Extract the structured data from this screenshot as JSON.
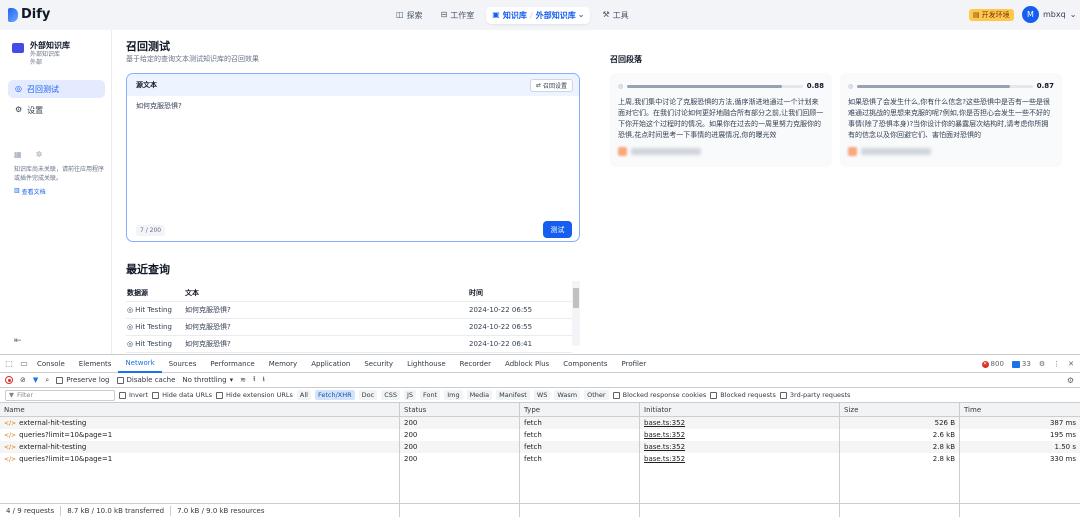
{
  "app": {
    "logo": "Dify",
    "nav": {
      "explore": "探索",
      "studio": "工作室",
      "knowledge": "知识库",
      "knowledge_sub": "外部知识库",
      "tools": "工具"
    },
    "env_badge": "开发环境",
    "user": {
      "initial": "M",
      "name": "mbxq"
    }
  },
  "sidebar": {
    "kb_name": "外部知识库",
    "kb_type": "外部知识库",
    "kb_sub": "外部",
    "items": [
      {
        "label": "召回测试"
      },
      {
        "label": "设置"
      }
    ],
    "note": "知识库尚未关联，请前往应用程序或插件完成关联。",
    "doc_link": "查看文档"
  },
  "main": {
    "title": "召回测试",
    "subtitle": "基于给定的查询文本测试知识库的召回效果",
    "source_label": "源文本",
    "setting_button": "召回设置",
    "query": "如何克服恐惧?",
    "counter": "7 / 200",
    "test_button": "测试",
    "recent_title": "最近查询",
    "recent": {
      "headers": [
        "数据源",
        "文本",
        "时间"
      ],
      "rows": [
        [
          "Hit Testing",
          "如何克服恐惧?",
          "2024-10-22 06:55"
        ],
        [
          "Hit Testing",
          "如何克服恐惧?",
          "2024-10-22 06:55"
        ],
        [
          "Hit Testing",
          "如何克服恐惧?",
          "2024-10-22 06:41"
        ]
      ]
    }
  },
  "results": {
    "title": "召回段落",
    "cards": [
      {
        "score": 0.88,
        "score_label": "0.88",
        "text": "上周,我们集中讨论了克服恐惧的方法,循序渐进地通过一个计划来面对它们。在我们讨论如何更好地融合所有部分之前,让我们回顾一下你开始这个过程时的情况。如果你在过去的一周里努力克服你的恐惧,花点时间思考一下事情的进展情况,你的曝光效"
      },
      {
        "score": 0.87,
        "score_label": "0.87",
        "text": "如果恐惧了会发生什么,你有什么信念?这些恐惧中是否有一些是很难通过挑战的思想来克服的呢?例如,你是否担心会发生一些不好的事情(除了恐惧本身)?当你设计你的暴露层次结构时,请考虑你所拥有的信念以及你回避它们、害怕面对恐惧的"
      }
    ]
  },
  "devtools": {
    "tabs": [
      "Console",
      "Elements",
      "Network",
      "Sources",
      "Performance",
      "Memory",
      "Application",
      "Security",
      "Lighthouse",
      "Recorder",
      "Adblock Plus",
      "Components",
      "Profiler"
    ],
    "errors": "800",
    "messages": "33",
    "toolbar": {
      "preserve_log": "Preserve log",
      "disable_cache": "Disable cache",
      "throttling": "No throttling"
    },
    "filter": {
      "placeholder": "Filter",
      "invert": "Invert",
      "hide_data_urls": "Hide data URLs",
      "hide_ext_urls": "Hide extension URLs",
      "chips": [
        "All",
        "Fetch/XHR",
        "Doc",
        "CSS",
        "JS",
        "Font",
        "Img",
        "Media",
        "Manifest",
        "WS",
        "Wasm",
        "Other"
      ],
      "blocked_cookies": "Blocked response cookies",
      "blocked_requests": "Blocked requests",
      "third_party": "3rd-party requests"
    },
    "columns": [
      "Name",
      "Status",
      "Type",
      "Initiator",
      "Size",
      "Time"
    ],
    "requests": [
      [
        "external-hit-testing",
        "200",
        "fetch",
        "base.ts:352",
        "526 B",
        "387 ms"
      ],
      [
        "queries?limit=10&page=1",
        "200",
        "fetch",
        "base.ts:352",
        "2.6 kB",
        "195 ms"
      ],
      [
        "external-hit-testing",
        "200",
        "fetch",
        "base.ts:352",
        "2.8 kB",
        "1.50 s"
      ],
      [
        "queries?limit=10&page=1",
        "200",
        "fetch",
        "base.ts:352",
        "2.8 kB",
        "330 ms"
      ]
    ],
    "status": {
      "requests": "4 / 9 requests",
      "transferred": "8.7 kB / 10.0 kB transferred",
      "resources": "7.0 kB / 9.0 kB resources"
    }
  }
}
